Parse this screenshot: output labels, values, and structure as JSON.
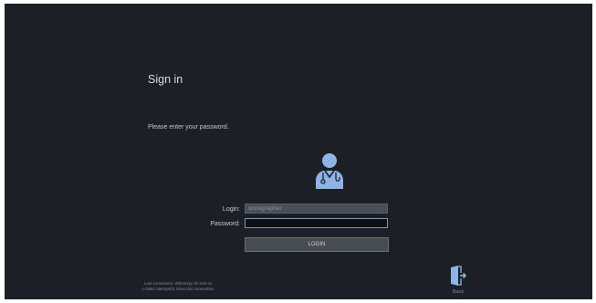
{
  "screen": {
    "title": "Sign in",
    "instruction": "Please enter your password."
  },
  "form": {
    "login_label": "Login:",
    "login_value": "sonographer",
    "password_label": "Password:",
    "password_value": "",
    "login_button_label": "LOGIN"
  },
  "footer": {
    "last_connection_line1": "Last connection: dd/mm/yy hh:mm:ss",
    "last_connection_line2": "x failed attempt(s) since last connection",
    "back_label": "Back"
  },
  "icons": {
    "avatar": "doctor-user-icon",
    "back": "exit-door-icon"
  },
  "colors": {
    "background": "#1c1f25",
    "accent": "#8fb4e3",
    "focus_border": "#7f97bd"
  }
}
